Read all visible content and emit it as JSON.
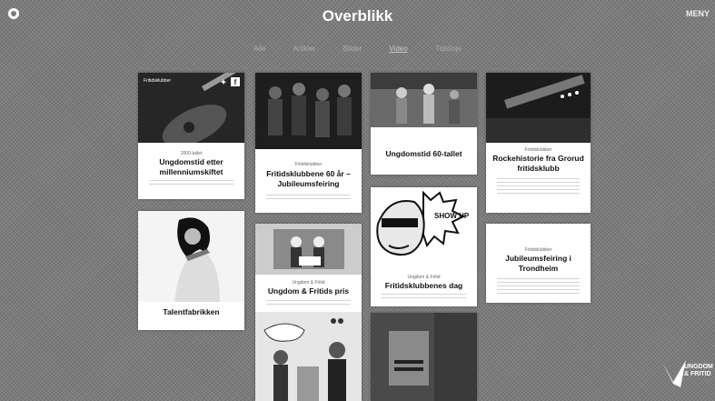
{
  "header": {
    "title": "Overblikk",
    "top_right": "MENY"
  },
  "filters": [
    "Alle",
    "Artikler",
    "Bilder",
    "Video",
    "Tidslinje"
  ],
  "cards": [
    {
      "title": "Ungdomstid etter millenniumskiftet",
      "meta": "2000-tallet",
      "image_label": "Fritidsklubber"
    },
    {
      "title": "Talentfabrikken"
    },
    {
      "title": "Fritidsklubbene 60 år – Jubileumsfeiring",
      "meta": "Fritidsklubber"
    },
    {
      "title": "Ungdom & Fritids pris",
      "meta": "Ungdom & Fritid"
    },
    {
      "title": "Ungdomstid 60-tallet"
    },
    {
      "title": "Fritidsklubbenes dag",
      "meta": "Ungdom & Fritid",
      "speech": "SHOW UP"
    },
    {
      "title": "Rockehistorie fra Grorud fritidsklubb",
      "meta": "Fritidsklubber"
    },
    {
      "title": "Jubileumsfeiring i Trondheim",
      "meta": "Fritidsklubber"
    }
  ],
  "brand": {
    "line1": "UNGDOM",
    "line2": "& FRITID"
  }
}
